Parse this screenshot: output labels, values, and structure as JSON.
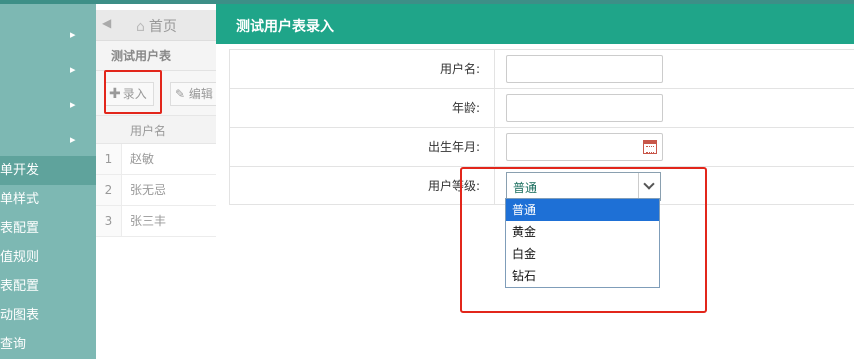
{
  "sidebar": {
    "items": [
      {
        "label": "单开发"
      },
      {
        "label": "单样式"
      },
      {
        "label": "表配置"
      },
      {
        "label": "值规则"
      },
      {
        "label": "表配置"
      },
      {
        "label": "动图表"
      },
      {
        "label": "查询"
      }
    ]
  },
  "tabs": {
    "home_label": "首页"
  },
  "panel": {
    "title": "测试用户表",
    "toolbar": {
      "add_label": "录入",
      "edit_label": "编辑"
    },
    "grid": {
      "columns": [
        "用户名"
      ],
      "rows": [
        {
          "num": "1",
          "name": "赵敏"
        },
        {
          "num": "2",
          "name": "张无忌"
        },
        {
          "num": "3",
          "name": "张三丰"
        }
      ]
    }
  },
  "dialog": {
    "title": "测试用户表录入",
    "fields": {
      "username_label": "用户名:",
      "age_label": "年龄:",
      "birth_label": "出生年月:",
      "level_label": "用户等级:"
    },
    "level_select": {
      "value": "普通",
      "options": [
        "普通",
        "黄金",
        "白金",
        "钻石"
      ],
      "selected_index": 0
    }
  },
  "colors": {
    "header_green": "#1fa589",
    "sidebar": "#7db8b3",
    "highlight_red": "#e2261b",
    "option_selected": "#1e70d6"
  }
}
